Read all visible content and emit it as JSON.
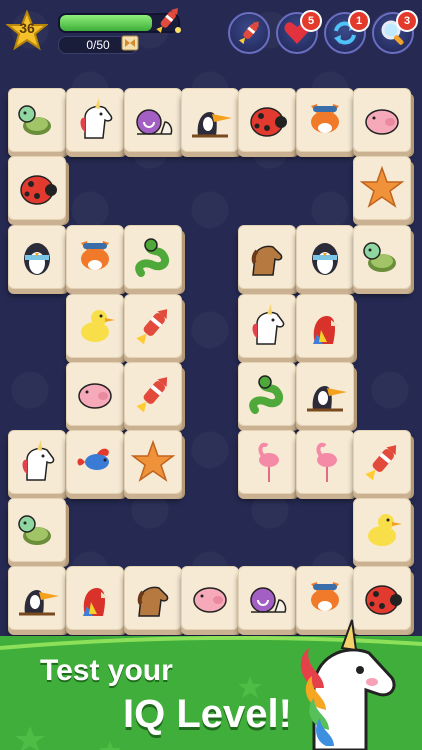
{
  "hud": {
    "level": "36",
    "progress_fraction": 0.78,
    "counter": "0/50",
    "powerups": [
      {
        "icon": "rocket-icon",
        "badge": ""
      },
      {
        "icon": "heart-icon",
        "badge": "5"
      },
      {
        "icon": "shuffle-icon",
        "badge": "1"
      },
      {
        "icon": "magnifier-icon",
        "badge": "3"
      }
    ]
  },
  "board": {
    "tiles": [
      "turtle",
      "unicorn",
      "snail",
      "toucan",
      "ladybug",
      "fox",
      "pig",
      "ladybug",
      "starfish",
      "penguin",
      "fox",
      "snake",
      "horse",
      "penguin",
      "turtle",
      "duck",
      "rocket",
      "unicorn",
      "parrot",
      "pig",
      "rocket",
      "snake",
      "toucan",
      "unicorn",
      "betta-fish",
      "starfish",
      "flamingo",
      "flamingo",
      "rocket",
      "turtle",
      "duck",
      "toucan",
      "parrot",
      "horse",
      "pig",
      "snail",
      "fox",
      "ladybug"
    ]
  },
  "banner": {
    "line1": "Test your",
    "line2": "IQ Level!"
  },
  "colors": {
    "background": "#262a52",
    "tile": "#f7ead4",
    "banner": "#3fae3a"
  }
}
